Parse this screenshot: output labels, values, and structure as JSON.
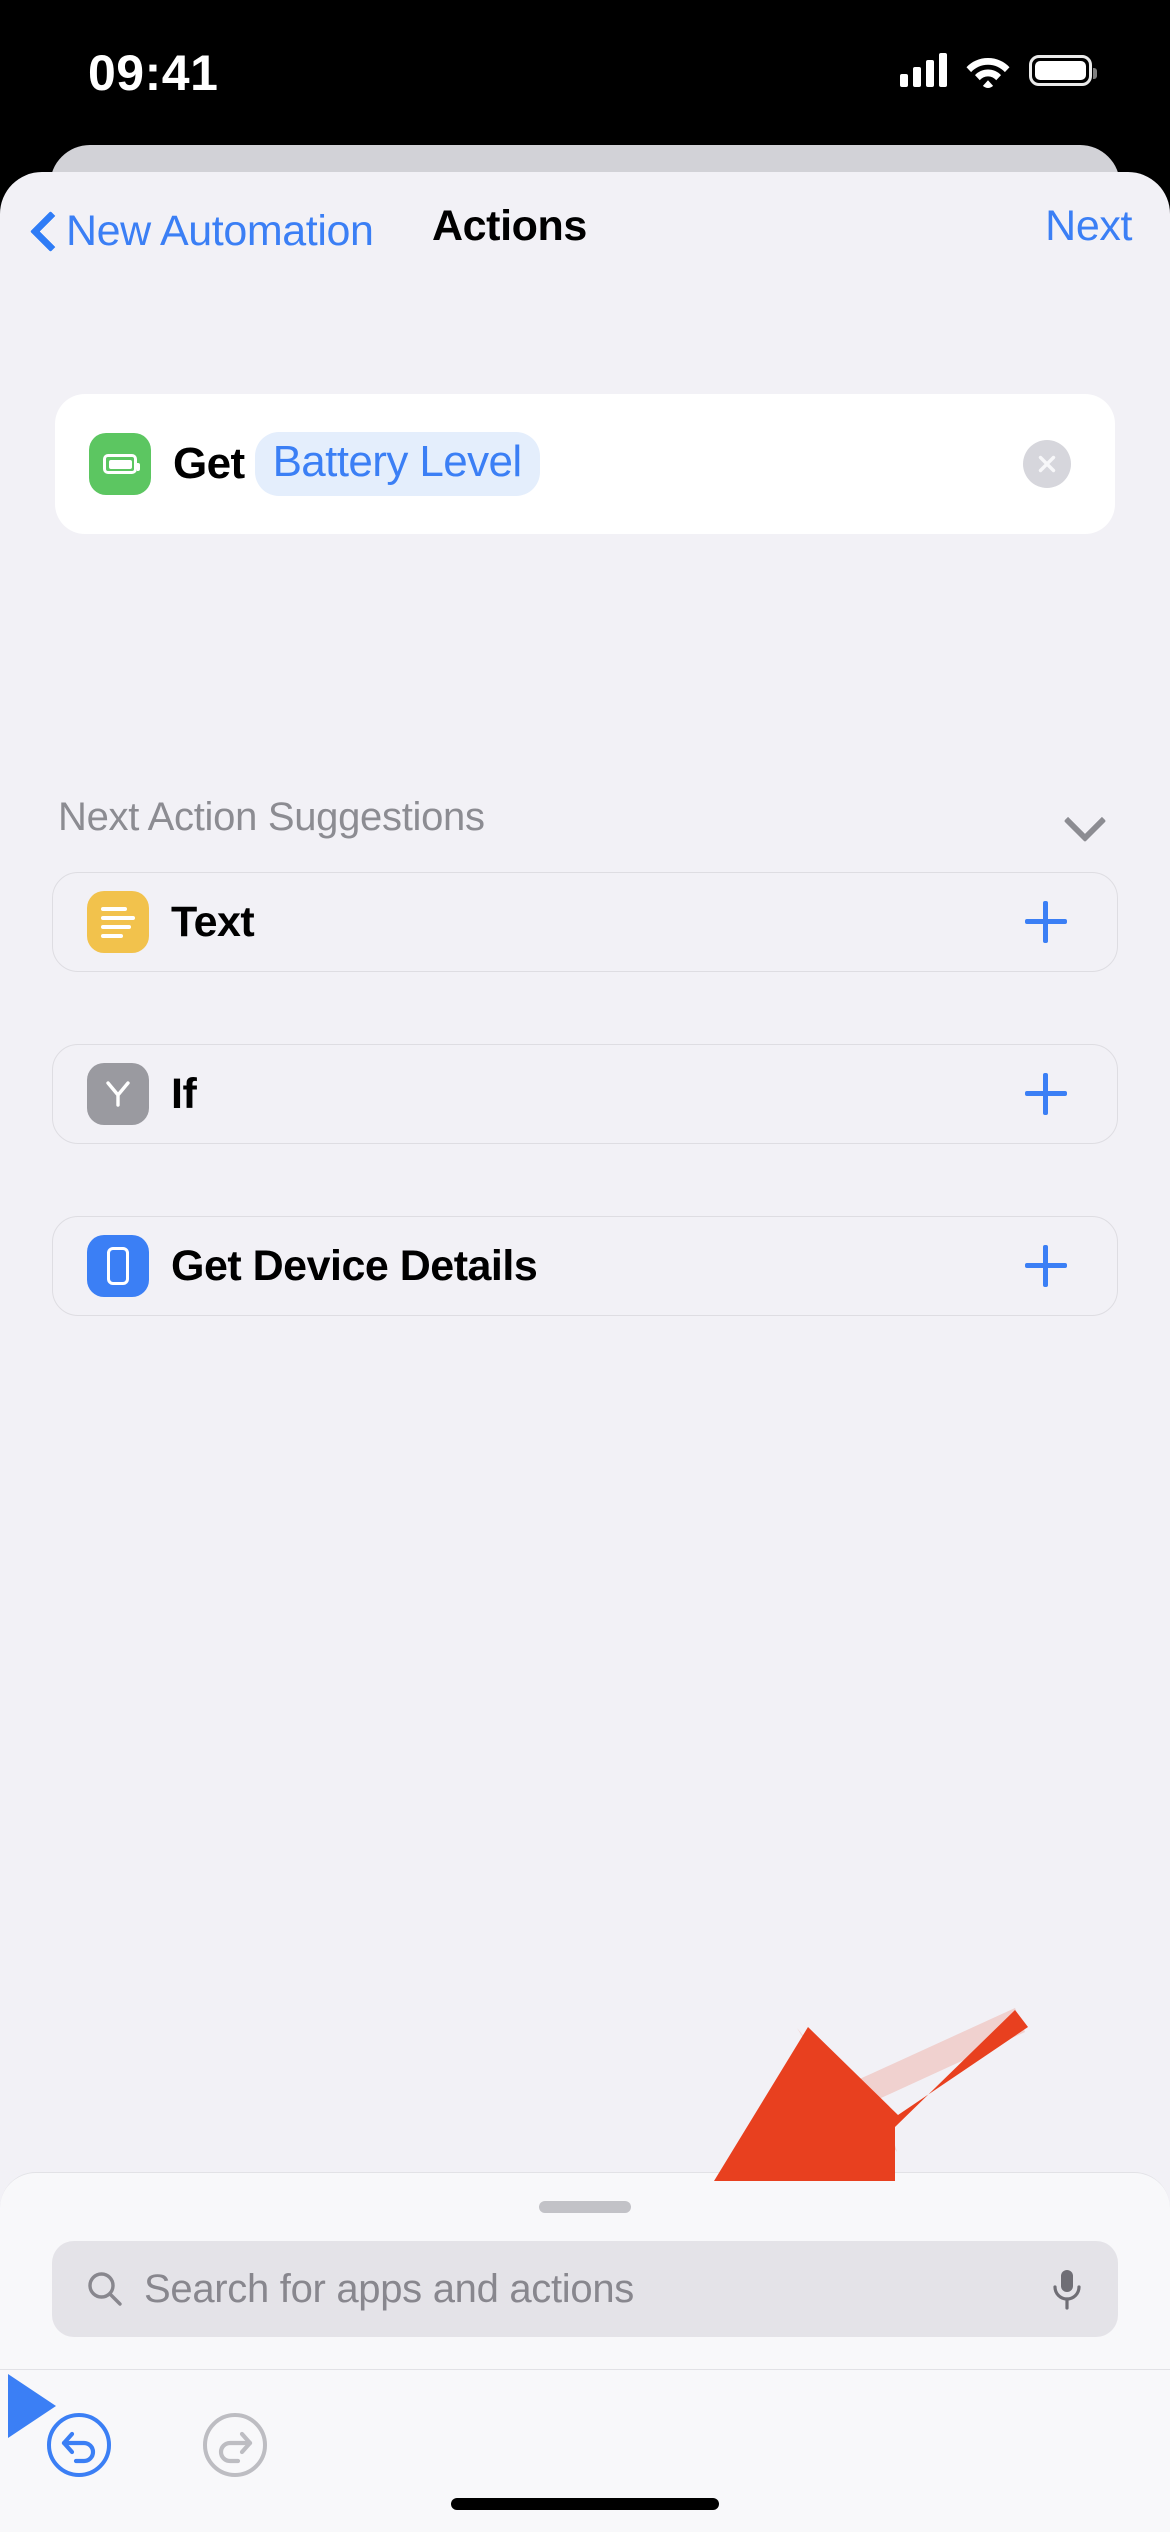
{
  "status_bar": {
    "time": "09:41",
    "cellular_icon": "cellular-signal-icon",
    "wifi_icon": "wifi-icon",
    "battery_icon": "battery-full-icon"
  },
  "nav": {
    "back_label": "New Automation",
    "back_icon": "chevron-left-icon",
    "title": "Actions",
    "next_label": "Next",
    "accent_color": "#3b7ff5"
  },
  "action": {
    "icon": "battery-icon",
    "icon_color": "#5cc661",
    "verb": "Get",
    "variable": "Battery Level",
    "variable_color": "#3b7ff5",
    "variable_bg": "#e4eefc",
    "remove_icon": "close-circle-icon"
  },
  "suggestions": {
    "header": "Next Action Suggestions",
    "collapse_icon": "chevron-down-icon",
    "items": [
      {
        "label": "Text",
        "icon": "text-lines-icon",
        "icon_color": "#f2c24c",
        "add_icon": "plus-icon"
      },
      {
        "label": "If",
        "icon": "branch-icon",
        "icon_color": "#9a9aa0",
        "add_icon": "plus-icon"
      },
      {
        "label": "Get Device Details",
        "icon": "phone-icon",
        "icon_color": "#3b7ff5",
        "add_icon": "plus-icon"
      }
    ]
  },
  "search": {
    "placeholder": "Search for apps and actions",
    "value": "",
    "search_icon": "search-icon",
    "mic_icon": "microphone-icon",
    "grabber": "sheet-grabber-handle"
  },
  "toolbar": {
    "undo_icon": "undo-icon",
    "redo_icon": "redo-icon",
    "play_icon": "play-icon",
    "undo_enabled_color": "#3b7ff5",
    "redo_disabled_color": "#bdbdc2"
  },
  "annotation": {
    "arrow_color": "#e8401f",
    "points_to": "search-input"
  }
}
